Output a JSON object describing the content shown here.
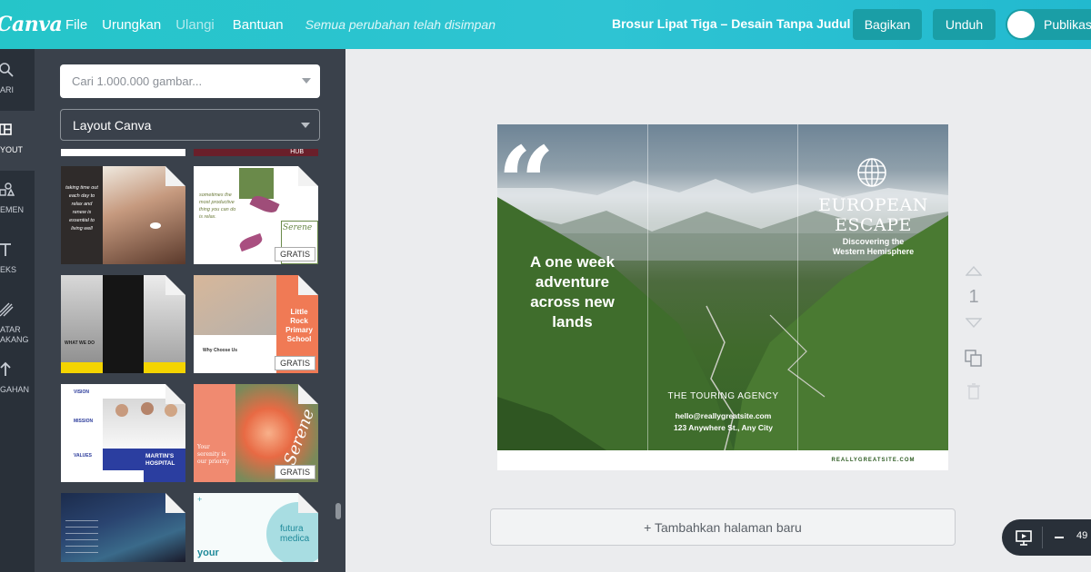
{
  "app": {
    "logo": "Canva"
  },
  "menu": {
    "file": "File",
    "undo": "Urungkan",
    "redo": "Ulangi",
    "help": "Bantuan",
    "saved_status": "Semua perubahan telah disimpan"
  },
  "document": {
    "title": "Brosur Lipat Tiga – Desain Tanpa Judul"
  },
  "actions": {
    "share": "Bagikan",
    "download": "Unduh",
    "publish": "Publikas"
  },
  "rail": [
    {
      "label": "ARI",
      "icon": "search-icon"
    },
    {
      "label": "YOUT",
      "icon": "layout-icon"
    },
    {
      "label": "EMEN",
      "icon": "elements-icon"
    },
    {
      "label": "EKS",
      "icon": "text-icon"
    },
    {
      "label": "ATAR\nAKANG",
      "icon": "background-icon"
    },
    {
      "label": "GAHAN",
      "icon": "upload-icon"
    }
  ],
  "panel": {
    "search_placeholder": "Cari 1.000.000 gambar...",
    "layout_select": "Layout Canva",
    "top_partial_label": "HUB",
    "thumbs": [
      {
        "name": "spa",
        "text": "taking time out each day to relax and renew is essential to living well",
        "badge": ""
      },
      {
        "name": "serene",
        "text": "sometimes the most productive thing you can do is relax.",
        "title": "Serene",
        "badge": "GRATIS"
      },
      {
        "name": "dark-lab",
        "text": "WHAT WE DO",
        "badge": ""
      },
      {
        "name": "little-rock",
        "text": "Why Choose Us",
        "title": "Little Rock Primary School",
        "badge": "GRATIS"
      },
      {
        "name": "hospital",
        "vision": "VISION",
        "mission": "MISSION",
        "values": "VALUES",
        "title": "MARTIN'S HOSPITAL",
        "badge": ""
      },
      {
        "name": "serene-flower",
        "text": "Your serenity is our priority",
        "title": "Serene",
        "badge": "GRATIS"
      },
      {
        "name": "space",
        "text": "",
        "badge": ""
      },
      {
        "name": "futura",
        "title": "futura medica",
        "text": "your",
        "badge": ""
      }
    ]
  },
  "design": {
    "quote_mark": "“",
    "tagline": "A one week adventure across new lands",
    "agency": "THE TOURING AGENCY",
    "email": "hello@reallygreatsite.com",
    "address": "123 Anywhere St., Any City",
    "title_line1": "EUROPEAN",
    "title_line2": "ESCAPE",
    "subtitle_line1": "Discovering the",
    "subtitle_line2": "Western Hemisphere",
    "website": "REALLYGREATSITE.COM"
  },
  "page_number": "1",
  "add_page": "+ Tambahkan halaman baru",
  "zoom": "49"
}
